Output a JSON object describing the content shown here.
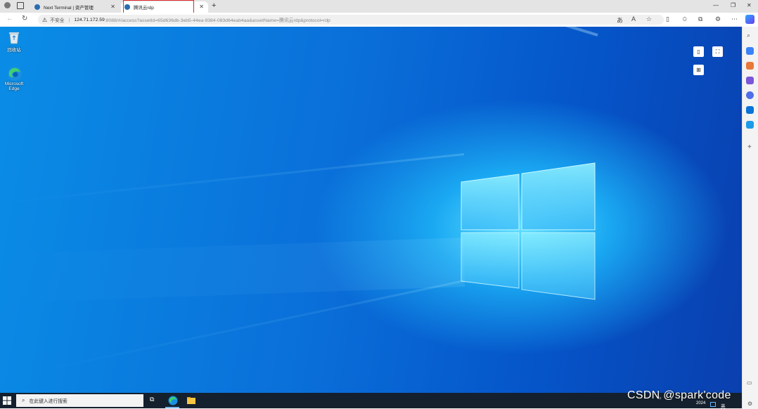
{
  "browser": {
    "tabs": [
      {
        "label": "Next Terminal | 资产管理",
        "active": false
      },
      {
        "label": "腾讯云rdp",
        "active": true
      }
    ],
    "new_tab_icon": "plus-icon",
    "address": {
      "security_label": "不安全",
      "host": "124.71.172.59",
      "path": ":8088/#/access?assetId=65d636db-3eb5-44ea-9384-083d64eab4aa&assetName=腾讯云rdp&protocol=rdp"
    }
  },
  "desktop": {
    "icons": [
      {
        "label": "回收站",
        "icon": "recycle-bin-icon"
      },
      {
        "label": "Microsoft Edge",
        "icon": "edge-icon"
      }
    ],
    "controls": [
      "clipboard-icon",
      "fullscreen-icon",
      "windows-key-icon"
    ]
  },
  "taskbar": {
    "search_placeholder": "在此键入进行搜索",
    "tray_lang": "英",
    "clock_year": "2024"
  },
  "watermark": "CSDN @spark'code",
  "colors": {
    "accent": "#0a6fd9",
    "tab_highlight": "#e0282e",
    "taskbar": "#14202e"
  }
}
